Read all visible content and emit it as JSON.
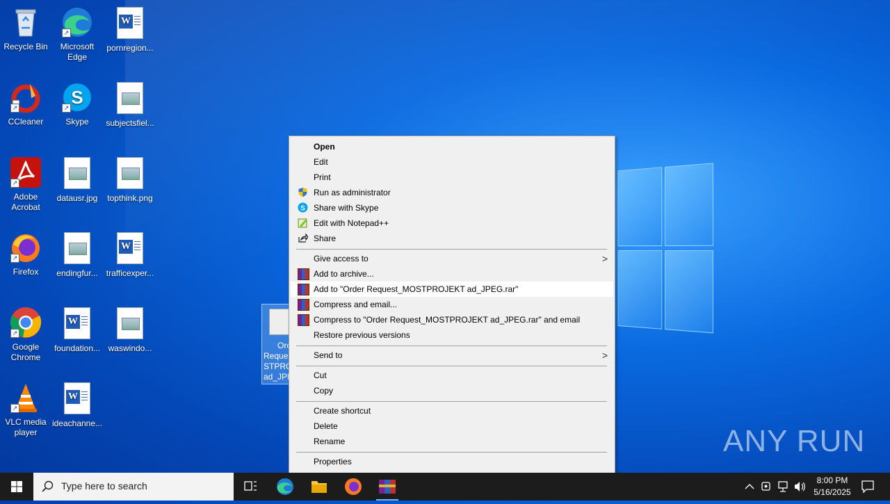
{
  "desktop": {
    "icons": [
      {
        "label": "Recycle Bin"
      },
      {
        "label": "Microsoft Edge"
      },
      {
        "label": "pornregion..."
      },
      {
        "label": "CCleaner"
      },
      {
        "label": "Skype"
      },
      {
        "label": "subjectsfiel..."
      },
      {
        "label": "Adobe Acrobat"
      },
      {
        "label": "datausr.jpg"
      },
      {
        "label": "topthink.png"
      },
      {
        "label": "Firefox"
      },
      {
        "label": "endingfur..."
      },
      {
        "label": "trafficexper..."
      },
      {
        "label": "Google Chrome"
      },
      {
        "label": "foundation..."
      },
      {
        "label": "waswindo..."
      },
      {
        "label": "VLC media player"
      },
      {
        "label": "ideachanne..."
      }
    ],
    "selected_file": {
      "label": "Order Request_MOSTPROJEKT ad_JPEG",
      "partial_lines": [
        "Orc",
        "Reques",
        "STPRC",
        "ad_JPE("
      ]
    }
  },
  "context_menu": {
    "items": [
      {
        "label": "Open",
        "icon": "none"
      },
      {
        "label": "Edit",
        "icon": "none"
      },
      {
        "label": "Print",
        "icon": "none"
      },
      {
        "label": "Run as administrator",
        "icon": "uac-shield-icon"
      },
      {
        "label": "Share with Skype",
        "icon": "skype-icon"
      },
      {
        "label": "Edit with Notepad++",
        "icon": "notepadpp-icon"
      },
      {
        "label": "Share",
        "icon": "share-icon"
      },
      {
        "label": "Give access to",
        "icon": "none",
        "submenu": true
      },
      {
        "label": "Add to archive...",
        "icon": "winrar-icon"
      },
      {
        "label": "Add to \"Order Request_MOSTPROJEKT ad_JPEG.rar\"",
        "icon": "winrar-icon"
      },
      {
        "label": "Compress and email...",
        "icon": "winrar-icon"
      },
      {
        "label": "Compress to \"Order Request_MOSTPROJEKT ad_JPEG.rar\" and email",
        "icon": "winrar-icon"
      },
      {
        "label": "Restore previous versions",
        "icon": "none"
      },
      {
        "label": "Send to",
        "icon": "none",
        "submenu": true
      },
      {
        "label": "Cut",
        "icon": "none"
      },
      {
        "label": "Copy",
        "icon": "none"
      },
      {
        "label": "Create shortcut",
        "icon": "none"
      },
      {
        "label": "Delete",
        "icon": "none"
      },
      {
        "label": "Rename",
        "icon": "none"
      },
      {
        "label": "Properties",
        "icon": "none"
      }
    ],
    "submenu_arrow": ">"
  },
  "watermark": {
    "text": "ANY RUN"
  },
  "taskbar": {
    "search_placeholder": "Type here to search",
    "pinned": [
      "task-view",
      "edge",
      "file-explorer",
      "firefox",
      "winrar"
    ],
    "tray": {
      "time": "8:00 PM",
      "date": "5/16/2025"
    }
  },
  "colors": {
    "accent": "#0a6ae0",
    "taskbar": "#1c1c1c",
    "menu_bg": "#f0f0f0",
    "menu_highlight": "#ffffff"
  }
}
